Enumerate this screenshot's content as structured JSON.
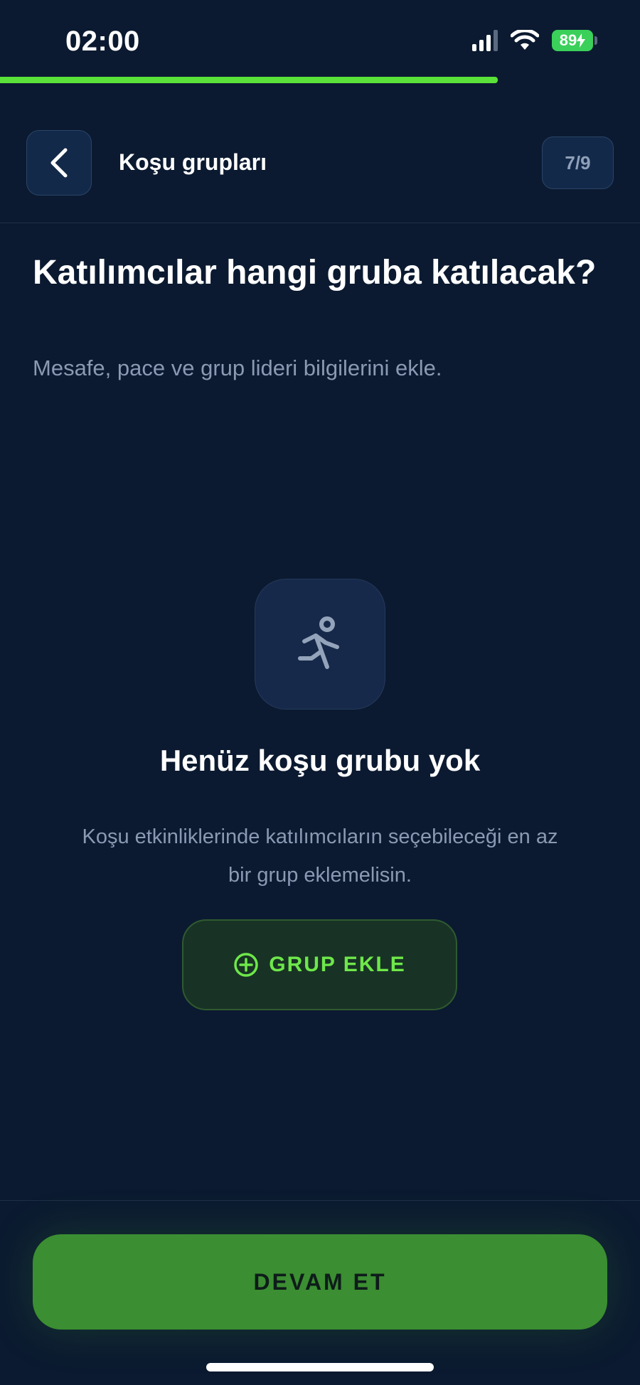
{
  "status_bar": {
    "time": "02:00",
    "battery": "89"
  },
  "progress": {
    "fraction": 0.778
  },
  "header": {
    "title": "Koşu grupları",
    "step": "7/9"
  },
  "question": {
    "title": "Katılımcılar hangi gruba katılacak?",
    "subtitle": "Mesafe, pace ve grup lideri bilgilerini ekle."
  },
  "empty_state": {
    "icon": "running-person-icon",
    "title": "Henüz koşu grubu yok",
    "description": "Koşu etkinliklerinde katılımcıların seçebileceği en az bir grup eklemelisin.",
    "add_button_label": "GRUP EKLE",
    "add_button_icon": "plus-circle-icon"
  },
  "footer": {
    "continue_label": "DEVAM ET"
  },
  "colors": {
    "background": "#0b1a30",
    "accent_green": "#5be23a",
    "primary_button": "#3b8e31",
    "muted_text": "#8a9ab3"
  }
}
